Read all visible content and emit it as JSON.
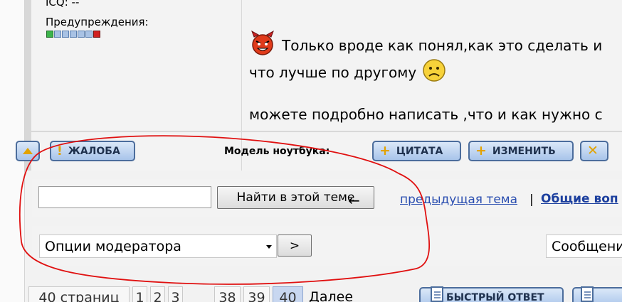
{
  "author": {
    "icq": "ICQ: --",
    "warnings_label": "Предупреждения:"
  },
  "post": {
    "line1": "Только вроде как понял,как это сделать и",
    "line2": "что лучше по другому",
    "line3": "можете подробно написать ,что и как нужно с"
  },
  "post_actions": {
    "report_label": "ЖАЛОБА",
    "model_label": "Модель ноутбука:",
    "quote_label": "ЦИТАТА",
    "edit_label": "ИЗМЕНИТЬ"
  },
  "search": {
    "input_value": "",
    "find_label": "Найти в этой теме",
    "arrow": "←",
    "prev_link": "предыдущая тема",
    "separator": "|",
    "general_link": "Общие воп"
  },
  "moderation": {
    "select_value": "Опции модератора",
    "go_label": ">",
    "messages_value": "Сообщени"
  },
  "pagination": {
    "total": "40 страниц",
    "pages": [
      "1",
      "2",
      "3",
      "38",
      "39",
      "40"
    ],
    "current": "40",
    "next": "Далее",
    "reply_label": "БЫСТРЫЙ ОТВЕТ"
  },
  "colors": {
    "button_border": "#4c6d9c",
    "link": "#2a4eb0",
    "annotation": "#e01010"
  }
}
